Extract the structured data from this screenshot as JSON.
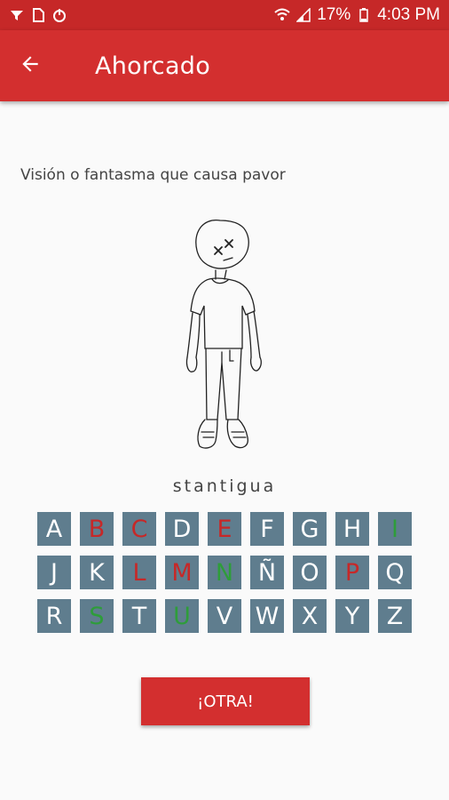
{
  "status_bar": {
    "battery": "17%",
    "time": "4:03 PM",
    "icons_left": [
      "notification-icon",
      "sim-card-icon",
      "power-icon"
    ],
    "icons_right": [
      "wifi-icon",
      "signal-icon",
      "battery-icon"
    ]
  },
  "app_bar": {
    "title": "Ahorcado",
    "back_icon": "arrow-back-icon"
  },
  "game": {
    "clue": "Visión o fantasma que causa pavor",
    "word": "stantigua",
    "figure": "hanged-man-drawing"
  },
  "keyboard": {
    "keys": [
      {
        "letter": "A",
        "state": "unused"
      },
      {
        "letter": "B",
        "state": "wrong"
      },
      {
        "letter": "C",
        "state": "wrong"
      },
      {
        "letter": "D",
        "state": "unused"
      },
      {
        "letter": "E",
        "state": "wrong"
      },
      {
        "letter": "F",
        "state": "unused"
      },
      {
        "letter": "G",
        "state": "unused"
      },
      {
        "letter": "H",
        "state": "unused"
      },
      {
        "letter": "I",
        "state": "right"
      },
      {
        "letter": "J",
        "state": "unused"
      },
      {
        "letter": "K",
        "state": "unused"
      },
      {
        "letter": "L",
        "state": "wrong"
      },
      {
        "letter": "M",
        "state": "wrong"
      },
      {
        "letter": "N",
        "state": "right"
      },
      {
        "letter": "Ñ",
        "state": "unused"
      },
      {
        "letter": "O",
        "state": "unused"
      },
      {
        "letter": "P",
        "state": "wrong"
      },
      {
        "letter": "Q",
        "state": "unused"
      },
      {
        "letter": "R",
        "state": "unused"
      },
      {
        "letter": "S",
        "state": "right"
      },
      {
        "letter": "T",
        "state": "unused"
      },
      {
        "letter": "U",
        "state": "right"
      },
      {
        "letter": "V",
        "state": "unused"
      },
      {
        "letter": "W",
        "state": "unused"
      },
      {
        "letter": "X",
        "state": "unused"
      },
      {
        "letter": "Y",
        "state": "unused"
      },
      {
        "letter": "Z",
        "state": "unused"
      }
    ]
  },
  "actions": {
    "again_label": "¡OTRA!"
  },
  "colors": {
    "primary": "#d32f2f",
    "primary_dark": "#c62828",
    "key_bg": "#5f7d8e",
    "wrong": "#c62828",
    "right": "#2e9d3a"
  }
}
